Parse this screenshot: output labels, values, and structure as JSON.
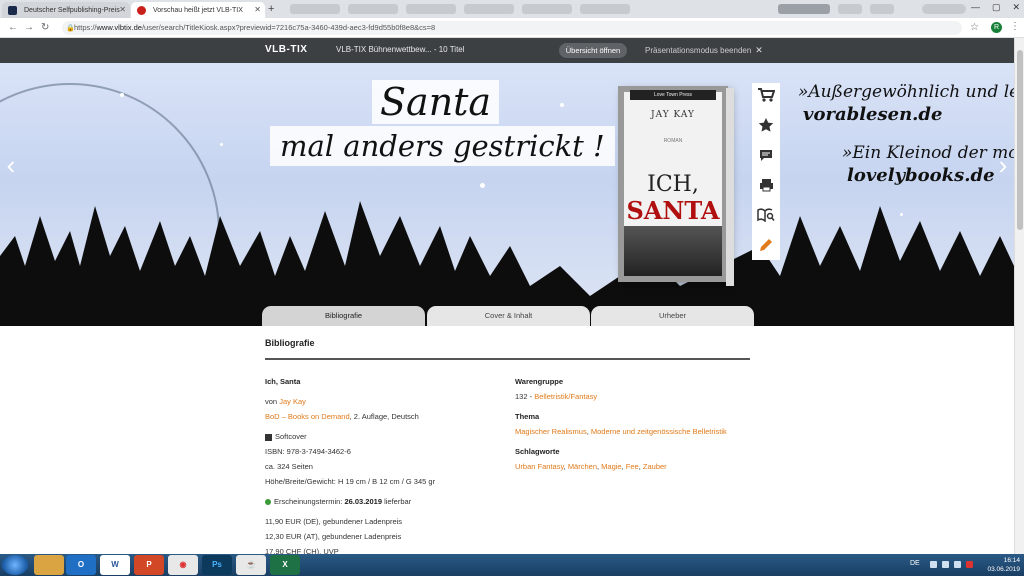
{
  "browser": {
    "tabs": [
      {
        "title": "Deutscher Selfpublishing-Preis",
        "active": false
      },
      {
        "title": "Vorschau heißt jetzt VLB-TIX",
        "active": true
      }
    ],
    "url_prefix": "https://",
    "url_host": "www.vlbtix.de",
    "url_path": "/user/search/TitleKiosk.aspx?previewid=7216c75a-3460-439d-aec3-fd9d55b0f8e8&cs=8"
  },
  "header": {
    "logo": "VLB-TIX",
    "title": "VLB-TIX Bühnenwettbew... - 10 Titel",
    "open_overview": "Übersicht öffnen",
    "end_presentation": "Präsentationsmodus beenden"
  },
  "hero": {
    "headline1": "Santa",
    "headline2": "mal anders gestrickt !",
    "quote1": "»Außergewöhnlich und lese",
    "source1": "vorablesen.de",
    "quote2": "»Ein Kleinod der mod",
    "source2": "lovelybooks.de",
    "book": {
      "publisher": "Love Town Press",
      "author": "JAY KAY",
      "label": "ROMAN",
      "title1": "ICH,",
      "title2": "SANTA"
    }
  },
  "sidebar_icons": [
    "cart-icon",
    "star-icon",
    "comment-icon",
    "print-icon",
    "book-search-icon",
    "pencil-icon"
  ],
  "section_tabs": [
    "Bibliografie",
    "Cover & Inhalt",
    "Urheber"
  ],
  "biblio": {
    "section_title": "Bibliografie",
    "title": "Ich, Santa",
    "by": "von",
    "author": "Jay Kay",
    "publisher": "BoD – Books on Demand",
    "edition": ", 2. Auflage, Deutsch",
    "format": "Softcover",
    "isbn": "ISBN: 978-3-7494-3462-6",
    "pages": "ca. 324 Seiten",
    "dimensions": "Höhe/Breite/Gewicht: H 19 cm / B 12 cm / G 345 gr",
    "release_label": "Erscheinungstermin: ",
    "release_date": "26.03.2019",
    "release_status": " lieferbar",
    "prices": [
      "11,90 EUR (DE), gebundener Ladenpreis",
      "12,30 EUR (AT), gebundener Ladenpreis",
      "17,90 CHF (CH), UVP"
    ]
  },
  "meta": {
    "group_label": "Warengruppe",
    "group_code": "132 - ",
    "group_value": "Belletristik/Fantasy",
    "theme_label": "Thema",
    "theme_value1": "Magischer Realismus",
    "theme_sep": ", ",
    "theme_value2": "Moderne und zeitgenössische Belletristik",
    "keywords_label": "Schlagworte",
    "keywords": [
      "Urban Fantasy",
      "Märchen",
      "Magie",
      "Fee",
      "Zauber"
    ]
  },
  "taskbar": {
    "language": "DE",
    "time": "16:14",
    "date": "03.06.2019",
    "apps": [
      "explorer",
      "outlook",
      "word",
      "powerpoint",
      "chrome",
      "photoshop",
      "java",
      "excel"
    ]
  },
  "colors": {
    "accent": "#e07a1a",
    "header_bg": "#3c4043",
    "taskbar": "#1a3e63"
  }
}
